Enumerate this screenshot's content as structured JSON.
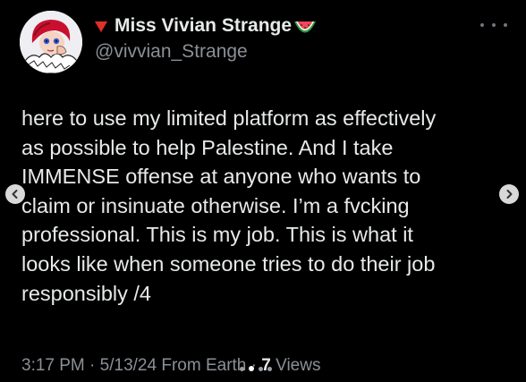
{
  "author": {
    "display_name": "Miss Vivian Strange",
    "handle": "@vivvian_Strange",
    "name_prefix_icon": "red-triangle-icon",
    "name_suffix_icon": "watermelon-icon"
  },
  "tweet": {
    "lines": [
      "here to use my limited platform as effectively",
      "as possible to help Palestine. And I take",
      "IMMENSE offense at anyone who wants to",
      "claim or insinuate otherwise. I’m a fvcking",
      "professional. This is my job. This is what it",
      "looks like when someone tries to do their job",
      "responsibly /4"
    ],
    "time": "3:17 PM",
    "date": "5/13/24",
    "separator": "·",
    "location": "From Earth",
    "views_count": "7",
    "views_label": "Views"
  },
  "carousel": {
    "page_count": 4,
    "active_index": 1
  },
  "colors": {
    "background": "#000000",
    "text": "#e7e9ea",
    "muted": "#8b9096",
    "accent_red": "#e0302a"
  }
}
